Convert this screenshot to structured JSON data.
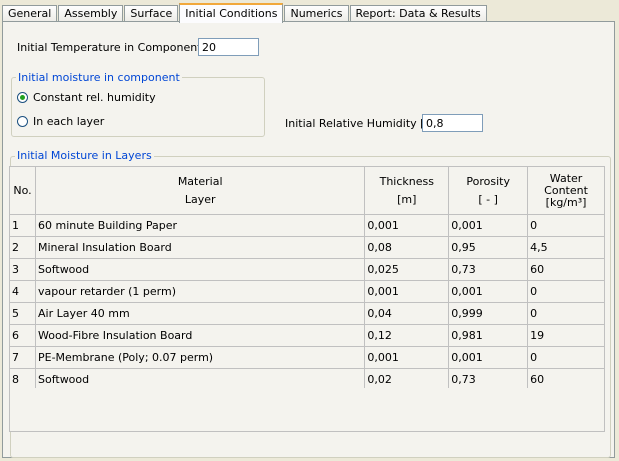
{
  "tabs": [
    {
      "label": "General"
    },
    {
      "label": "Assembly"
    },
    {
      "label": "Surface"
    },
    {
      "label": "Initial Conditions",
      "active": true
    },
    {
      "label": "Numerics"
    },
    {
      "label": "Report: Data & Results"
    }
  ],
  "initial_temperature": {
    "label": "Initial Temperature in Component  [°C]",
    "value": "20"
  },
  "moisture_group": {
    "title": "Initial moisture in component",
    "options": [
      {
        "label": "Constant rel. humidity",
        "selected": true
      },
      {
        "label": "In each layer",
        "selected": false
      }
    ]
  },
  "relative_humidity": {
    "label": "Initial Relative Humidity  [-]",
    "value": "0,8"
  },
  "layers_group": {
    "title": "Initial Moisture in Layers",
    "headers": {
      "no": "No.",
      "material_line1": "Material",
      "material_line2": "Layer",
      "thickness_line1": "Thickness",
      "thickness_line2": "[m]",
      "porosity_line1": "Porosity",
      "porosity_line2": "[ - ]",
      "water_line1": "Water",
      "water_line2": "Content",
      "water_line3": "[kg/m³]"
    },
    "rows": [
      {
        "no": "1",
        "material": "60 minute Building Paper",
        "thickness": "0,001",
        "porosity": "0,001",
        "water": "0"
      },
      {
        "no": "2",
        "material": "Mineral Insulation Board",
        "thickness": "0,08",
        "porosity": "0,95",
        "water": "4,5"
      },
      {
        "no": "3",
        "material": "Softwood",
        "thickness": "0,025",
        "porosity": "0,73",
        "water": "60"
      },
      {
        "no": "4",
        "material": "vapour retarder (1 perm)",
        "thickness": "0,001",
        "porosity": "0,001",
        "water": "0"
      },
      {
        "no": "5",
        "material": "Air Layer 40 mm",
        "thickness": "0,04",
        "porosity": "0,999",
        "water": "0"
      },
      {
        "no": "6",
        "material": "Wood-Fibre Insulation Board",
        "thickness": "0,12",
        "porosity": "0,981",
        "water": "19"
      },
      {
        "no": "7",
        "material": "PE-Membrane (Poly; 0.07 perm)",
        "thickness": "0,001",
        "porosity": "0,001",
        "water": "0"
      },
      {
        "no": "8",
        "material": "Softwood",
        "thickness": "0,02",
        "porosity": "0,73",
        "water": "60"
      }
    ]
  },
  "colors": {
    "background": "#ece9d8",
    "group_title": "#0046d5",
    "active_tab_accent": "#f1a83b",
    "radio_selected": "#21a121"
  }
}
